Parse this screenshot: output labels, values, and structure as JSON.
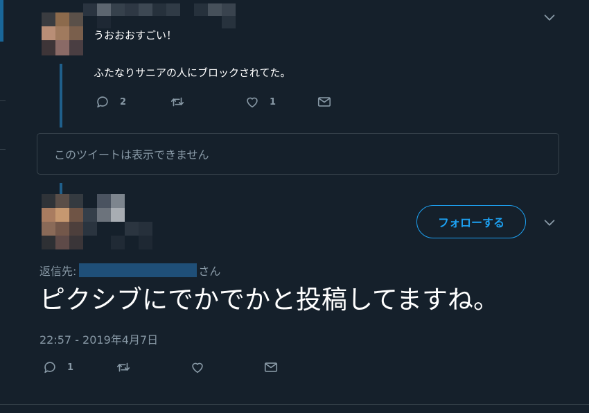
{
  "tweet1": {
    "line1": "うおおおすごい！",
    "line2": "ふたなりサニアの人にブロックされてた。",
    "actions": {
      "reply_count": "2",
      "like_count": "1"
    }
  },
  "unavailable_text": "このツイートは表示できません",
  "tweet2": {
    "follow_label": "フォローする",
    "reply_to_prefix": "返信先:",
    "reply_to_suffix": "さん",
    "text": "ピクシブにでかでかと投稿してますね。",
    "timestamp": "22:57 - 2019年4月7日",
    "actions": {
      "reply_count": "1"
    }
  },
  "colors": {
    "background": "#15202b",
    "accent": "#1da1f2",
    "secondary_text": "#8899a6",
    "border": "#38444d"
  },
  "icons": [
    "reply-icon",
    "retweet-icon",
    "like-icon",
    "dm-icon",
    "chevron-down-icon"
  ]
}
